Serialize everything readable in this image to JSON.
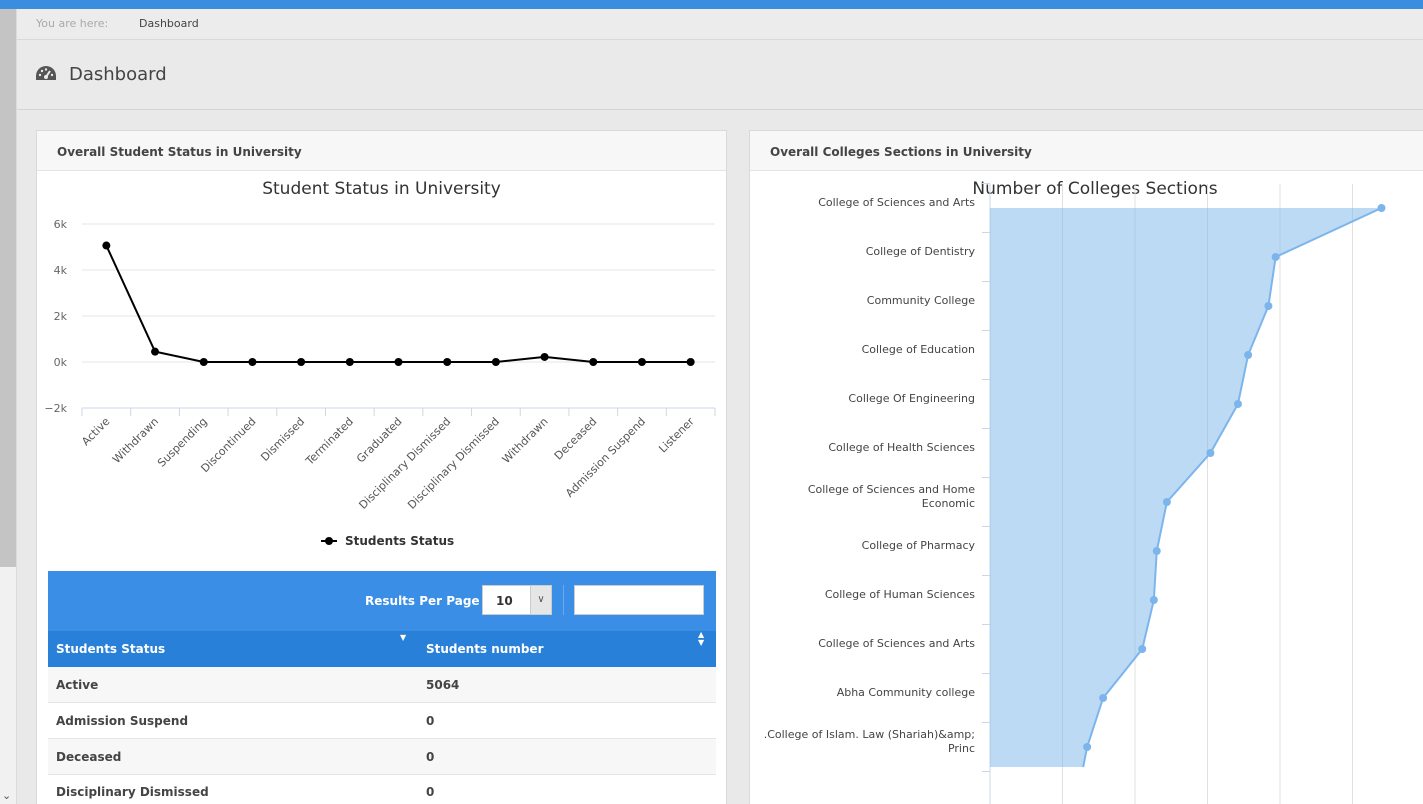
{
  "breadcrumb": {
    "prefix": "You are here:",
    "current": "Dashboard"
  },
  "page": {
    "title": "Dashboard"
  },
  "left_panel": {
    "heading": "Overall Student Status in University",
    "chart_title": "Student Status in University",
    "legend": "Students Status",
    "y_ticks": [
      "6k",
      "4k",
      "2k",
      "0k",
      "−2k"
    ]
  },
  "right_panel": {
    "heading": "Overall Colleges Sections in University",
    "chart_title": "Number of Colleges Sections"
  },
  "table": {
    "results_per_page_label": "Results Per Page :",
    "results_per_page_value": "10",
    "search_value": "",
    "columns": [
      "Students Status",
      "Students number"
    ],
    "rows": [
      [
        "Active",
        "5064"
      ],
      [
        "Admission Suspend",
        "0"
      ],
      [
        "Deceased",
        "0"
      ],
      [
        "Disciplinary Dismissed",
        "0"
      ]
    ]
  },
  "chart_data": [
    {
      "type": "line",
      "title": "Student Status in University",
      "categories": [
        "Active",
        "Withdrawn",
        "Suspending",
        "Discontinued",
        "Dismissed",
        "Terminated",
        "Graduated",
        "Disciplinary Dismissed",
        "Disciplinary Dismissed",
        "Withdrawn",
        "Deceased",
        "Admission Suspend",
        "Listener"
      ],
      "series": [
        {
          "name": "Students Status",
          "values": [
            5064,
            450,
            0,
            0,
            0,
            0,
            0,
            0,
            0,
            220,
            0,
            0,
            0
          ]
        }
      ],
      "ylim": [
        -2000,
        6000
      ],
      "grid": true,
      "legend": "bottom"
    },
    {
      "type": "area",
      "orientation": "horizontal",
      "title": "Number of Colleges Sections",
      "categories": [
        "College of Sciences and Arts",
        "College of Dentistry",
        "Community College",
        "College of Education",
        "College Of Engineering",
        "College of Health Sciences",
        "College of Sciences and Home Economic",
        "College of Pharmacy",
        "College of Human Sciences",
        "College of Sciences and Arts",
        "Abha Community college",
        ".College of Islam. Law (Shariah)&amp; Princ"
      ],
      "series": [
        {
          "values": [
            27,
            19.7,
            19.2,
            17.8,
            17.1,
            15.2,
            12.2,
            11.5,
            11.3,
            10.5,
            7.8,
            6.7
          ]
        }
      ],
      "grid": true,
      "color": "#7cb5ec"
    }
  ]
}
